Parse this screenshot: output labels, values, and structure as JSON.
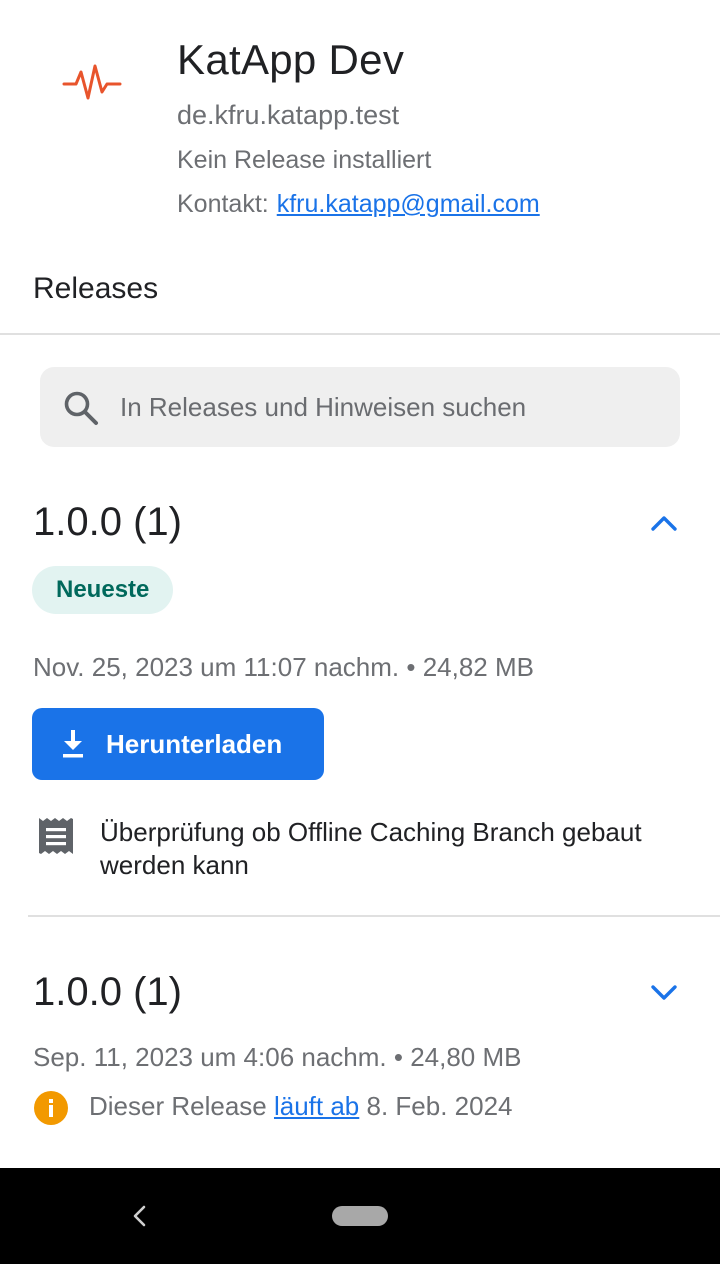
{
  "app": {
    "title": "KatApp Dev",
    "package": "de.kfru.katapp.test",
    "install_status": "Kein Release installiert",
    "contact_label": "Kontakt:",
    "contact_email": "kfru.katapp@gmail.com",
    "icon": "pulse-icon"
  },
  "section_title": "Releases",
  "search": {
    "placeholder": "In Releases und Hinweisen suchen"
  },
  "releases": [
    {
      "version": "1.0.0 (1)",
      "expanded": true,
      "badge": "Neueste",
      "meta": "Nov. 25, 2023 um 11:07 nachm. • 24,82 MB",
      "download_label": "Herunterladen",
      "notes": "Überprüfung ob Offline Caching Branch gebaut werden kann"
    },
    {
      "version": "1.0.0 (1)",
      "expanded": false,
      "meta": "Sep. 11, 2023 um 4:06 nachm. • 24,80 MB",
      "expiry_prefix": "Dieser Release",
      "expiry_link": "läuft ab",
      "expiry_date": "8. Feb. 2024"
    }
  ],
  "colors": {
    "accent": "#1a73e8",
    "badge_bg": "#e2f3f1",
    "badge_text": "#00695c",
    "app_icon": "#e8542c",
    "info": "#f29900"
  }
}
